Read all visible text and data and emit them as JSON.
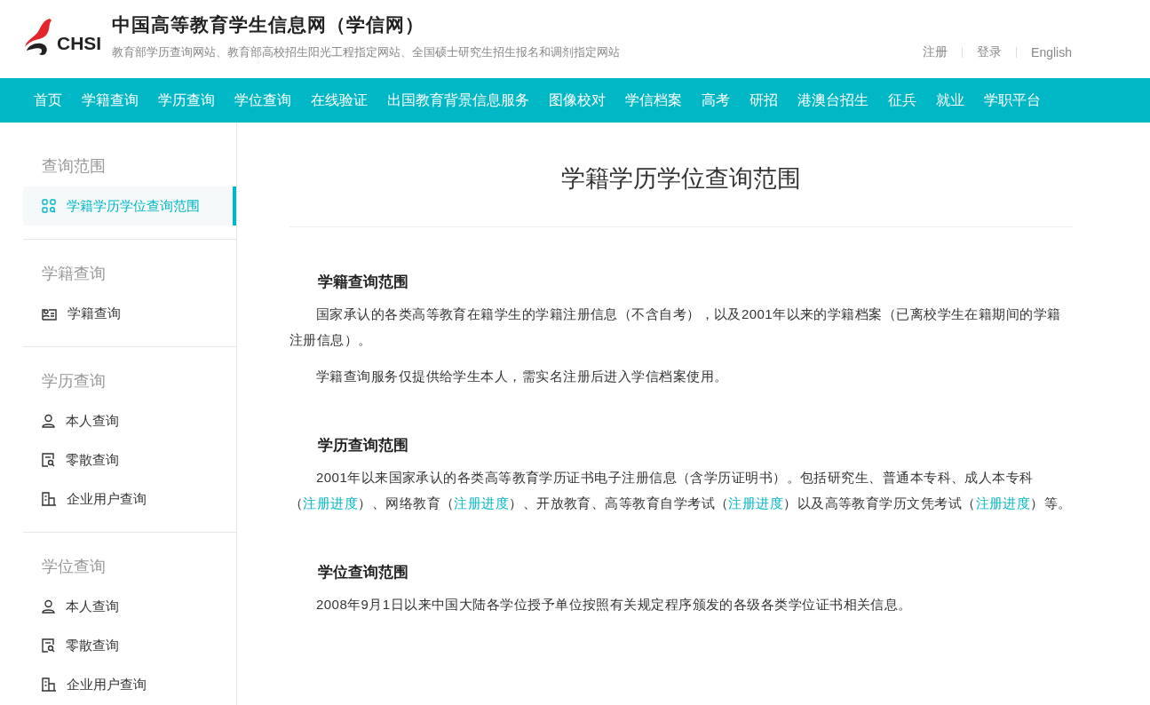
{
  "header": {
    "logo_text": "CHSI",
    "title": "中国高等教育学生信息网（学信网）",
    "subtitle": "教育部学历查询网站、教育部高校招生阳光工程指定网站、全国硕士研究生招生报名和调剂指定网站",
    "links": [
      "注册",
      "登录",
      "English"
    ]
  },
  "nav": [
    {
      "label": "首页"
    },
    {
      "label": "学籍查询"
    },
    {
      "label": "学历查询"
    },
    {
      "label": "学位查询"
    },
    {
      "label": "在线验证"
    },
    {
      "label": "出国教育背景信息服务"
    },
    {
      "label": "图像校对"
    },
    {
      "label": "学信档案"
    },
    {
      "label": "高考"
    },
    {
      "label": "研招"
    },
    {
      "label": "港澳台招生"
    },
    {
      "label": "征兵"
    },
    {
      "label": "就业"
    },
    {
      "label": "学职平台"
    }
  ],
  "sidebar": [
    {
      "title": "查询范围",
      "items": [
        {
          "label": "学籍学历学位查询范围",
          "kind": "grid",
          "selected": true
        }
      ]
    },
    {
      "title": "学籍查询",
      "items": [
        {
          "label": "学籍查询",
          "kind": "card",
          "selected": false
        }
      ]
    },
    {
      "title": "学历查询",
      "items": [
        {
          "label": "本人查询",
          "kind": "person",
          "selected": false
        },
        {
          "label": "零散查询",
          "kind": "doc",
          "selected": false
        },
        {
          "label": "企业用户查询",
          "kind": "building",
          "selected": false
        }
      ]
    },
    {
      "title": "学位查询",
      "items": [
        {
          "label": "本人查询",
          "kind": "person",
          "selected": false
        },
        {
          "label": "零散查询",
          "kind": "doc",
          "selected": false
        },
        {
          "label": "企业用户查询",
          "kind": "building",
          "selected": false
        }
      ]
    }
  ],
  "content": {
    "title": "学籍学历学位查询范围",
    "sections": [
      {
        "heading": "学籍查询范围",
        "paragraphs": [
          [
            {
              "kind": "text",
              "text": "国家承认的各类高等教育在籍学生的学籍注册信息（不含自考），以及2001年以来的学籍档案（已离校学生在籍期间的学籍注册信息）。"
            }
          ],
          [
            {
              "kind": "text",
              "text": "学籍查询服务仅提供给学生本人，需实名注册后进入学信档案使用。"
            }
          ]
        ]
      },
      {
        "heading": "学历查询范围",
        "paragraphs": [
          [
            {
              "kind": "text",
              "text": "2001年以来国家承认的各类高等教育学历证书电子注册信息（含学历证明书）。包括研究生、普通本专科、成人本专科（"
            },
            {
              "kind": "link",
              "text": "注册进度"
            },
            {
              "kind": "text",
              "text": "）、网络教育（"
            },
            {
              "kind": "link",
              "text": "注册进度"
            },
            {
              "kind": "text",
              "text": "）、开放教育、高等教育自学考试（"
            },
            {
              "kind": "link",
              "text": "注册进度"
            },
            {
              "kind": "text",
              "text": "）以及高等教育学历文凭考试（"
            },
            {
              "kind": "link",
              "text": "注册进度"
            },
            {
              "kind": "text",
              "text": "）等。"
            }
          ]
        ]
      },
      {
        "heading": "学位查询范围",
        "paragraphs": [
          [
            {
              "kind": "text",
              "text": "2008年9月1日以来中国大陆各学位授予单位按照有关规定程序颁发的各级各类学位证书相关信息。"
            }
          ]
        ]
      }
    ]
  }
}
